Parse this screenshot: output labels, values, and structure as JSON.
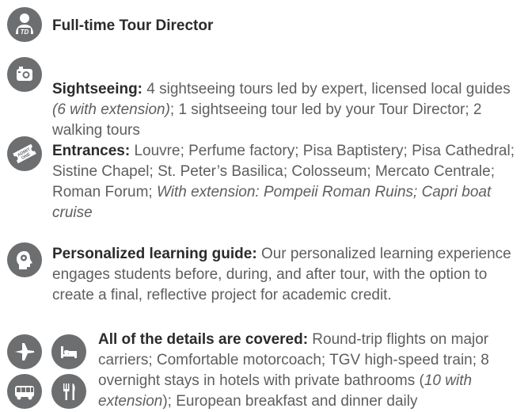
{
  "icons": {
    "tour_director": "tour-director-icon",
    "sightseeing": "camera-icon",
    "entrances": "admit-one-ticket-icon",
    "learning": "head-icon",
    "flights": "airplane-icon",
    "hotels": "bed-icon",
    "motorcoach": "bus-icon",
    "meals": "fork-knife-icon"
  },
  "icon_text": {
    "td_badge": "TD",
    "ticket_line1": "ADMIT",
    "ticket_line2": "ONE"
  },
  "colors": {
    "icon_bg": "#6d6e70",
    "heading": "#2b2b2b",
    "body_text": "#5e5e5e"
  },
  "items": {
    "tour_director": {
      "title": "Full-time Tour Director"
    },
    "sightseeing": {
      "title": "Sightseeing:",
      "text1": " 4 sightseeing tours led by expert, licensed local guides ",
      "italic1": "(6 with extension)",
      "text2": "; 1 sightseeing tour led by your Tour Director; 2 walking tours"
    },
    "entrances": {
      "title": "Entrances:",
      "text1": " Louvre; Perfume factory; Pisa Baptistery; Pisa Cathedral; Sistine Chapel; St. Peter’s Basilica; Colosseum; Mercato Centrale; Roman Forum; ",
      "italic1": "With extension: Pompeii Roman Ruins; Capri boat cruise"
    },
    "learning": {
      "title": "Personalized learning guide:",
      "text1": " Our personalized learning experience engages students before, during, and after tour, with the option to create a final, reflective project for academic credit."
    },
    "details": {
      "title": "All of the details are covered:",
      "text1": " Round-trip flights on major carriers; Comfortable motorcoach; TGV high-speed train; 8 overnight stays in hotels with private bathrooms (",
      "italic1": "10 with extension",
      "text2": "); European breakfast and dinner daily"
    }
  }
}
